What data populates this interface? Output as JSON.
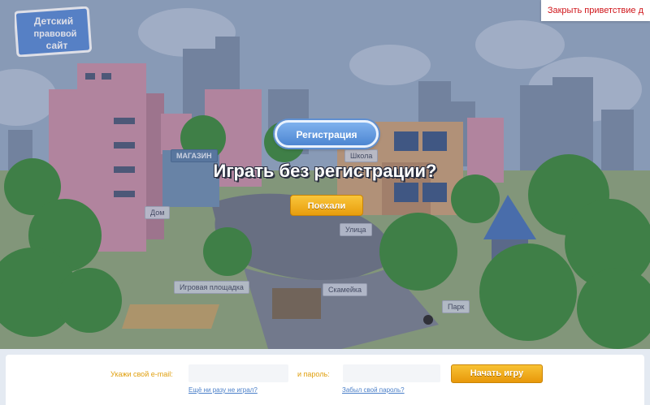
{
  "header": {
    "logo_text": "Детский правовой сайт",
    "close_welcome": "Закрыть приветствие д"
  },
  "map_labels": {
    "school": "Школа",
    "shop": "МАГАЗИН",
    "home": "Дом",
    "street": "Улица",
    "playground": "Игровая площадка",
    "bench": "Скамейка",
    "park": "Парк"
  },
  "center": {
    "register_label": "Регистрация",
    "play_title": "Играть без регистрации?",
    "go_label": "Поехали"
  },
  "login": {
    "email_label": "Укажи свой e-mail:",
    "email_value": "",
    "password_label": "и пароль:",
    "password_value": "",
    "start_label": "Начать игру",
    "never_played": "Ещё ни разу не играл?",
    "forgot_password": "Забыл свой пароль?"
  },
  "colors": {
    "accent_orange": "#e8980a",
    "register_blue": "#4d86d1",
    "close_red": "#d0161b",
    "link_blue": "#4a7fc9"
  }
}
